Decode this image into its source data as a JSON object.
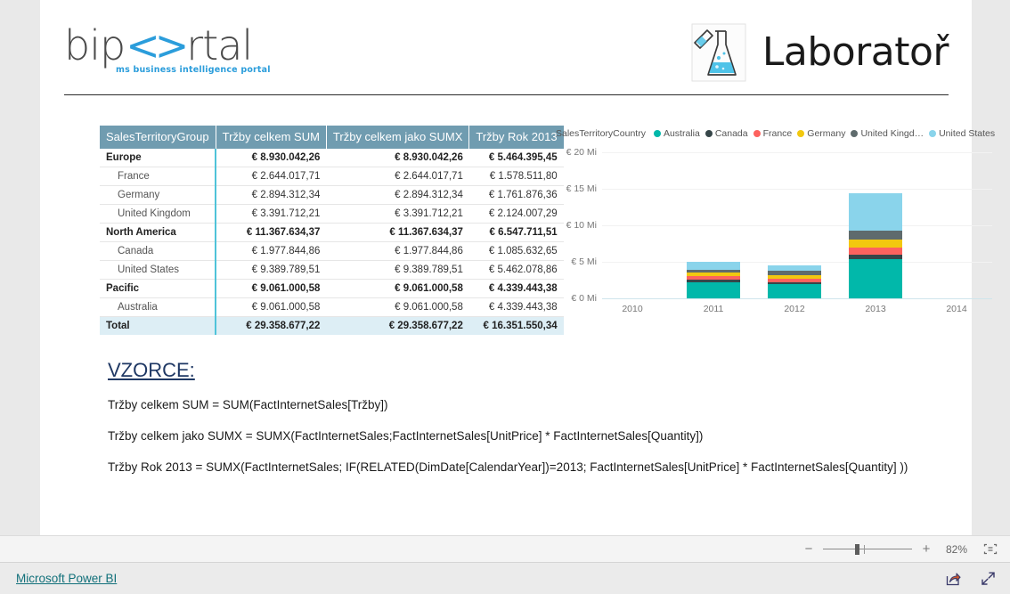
{
  "header": {
    "logo_left": {
      "word_a": "bip",
      "word_diamond": "<>",
      "word_b": "rtal",
      "tagline": "ms business intelligence portal"
    },
    "logo_right": {
      "title": "Laboratoř",
      "icon": "flask-icon"
    }
  },
  "matrix": {
    "columns": [
      "SalesTerritoryGroup",
      "Tržby celkem SUM",
      "Tržby celkem jako SUMX",
      "Tržby Rok 2013"
    ],
    "rows": [
      {
        "type": "group",
        "label": "Europe",
        "sum": "€ 8.930.042,26",
        "sumx": "€ 8.930.042,26",
        "y2013": "€ 5.464.395,45"
      },
      {
        "type": "sub",
        "label": "France",
        "sum": "€ 2.644.017,71",
        "sumx": "€ 2.644.017,71",
        "y2013": "€ 1.578.511,80"
      },
      {
        "type": "sub",
        "label": "Germany",
        "sum": "€ 2.894.312,34",
        "sumx": "€ 2.894.312,34",
        "y2013": "€ 1.761.876,36"
      },
      {
        "type": "sub",
        "label": "United Kingdom",
        "sum": "€ 3.391.712,21",
        "sumx": "€ 3.391.712,21",
        "y2013": "€ 2.124.007,29"
      },
      {
        "type": "group",
        "label": "North America",
        "sum": "€ 11.367.634,37",
        "sumx": "€ 11.367.634,37",
        "y2013": "€ 6.547.711,51"
      },
      {
        "type": "sub",
        "label": "Canada",
        "sum": "€ 1.977.844,86",
        "sumx": "€ 1.977.844,86",
        "y2013": "€ 1.085.632,65"
      },
      {
        "type": "sub",
        "label": "United States",
        "sum": "€ 9.389.789,51",
        "sumx": "€ 9.389.789,51",
        "y2013": "€ 5.462.078,86"
      },
      {
        "type": "group",
        "label": "Pacific",
        "sum": "€ 9.061.000,58",
        "sumx": "€ 9.061.000,58",
        "y2013": "€ 4.339.443,38"
      },
      {
        "type": "sub",
        "label": "Australia",
        "sum": "€ 9.061.000,58",
        "sumx": "€ 9.061.000,58",
        "y2013": "€ 4.339.443,38"
      },
      {
        "type": "total",
        "label": "Total",
        "sum": "€ 29.358.677,22",
        "sumx": "€ 29.358.677,22",
        "y2013": "€ 16.351.550,34"
      }
    ]
  },
  "chart_data": {
    "type": "bar",
    "stacked": true,
    "title": "",
    "legend_title": "SalesTerritoryCountry",
    "legend_position": "top",
    "grid": true,
    "xlabel": "",
    "ylabel": "",
    "categories": [
      "2010",
      "2011",
      "2012",
      "2013"
    ],
    "x_tick_labels": [
      "2010",
      "2011",
      "2012",
      "2014"
    ],
    "x_all_ticks": [
      "2010",
      "2011",
      "2012",
      "2013",
      "2014"
    ],
    "ytick_labels": [
      "€ 0 Mi",
      "€ 5 Mi",
      "€ 10 Mi",
      "€ 15 Mi",
      "€ 20 Mi"
    ],
    "ytick_values": [
      0,
      5000000,
      10000000,
      15000000,
      20000000
    ],
    "ylim": [
      0,
      20000000
    ],
    "series": [
      {
        "name": "Australia",
        "color": "#01b8aa",
        "values": [
          0,
          2150000,
          1900000,
          5350000
        ]
      },
      {
        "name": "Canada",
        "color": "#374649",
        "values": [
          0,
          380000,
          320000,
          650000
        ]
      },
      {
        "name": "France",
        "color": "#fd625e",
        "values": [
          0,
          480000,
          480000,
          900000
        ]
      },
      {
        "name": "Germany",
        "color": "#f2c80f",
        "values": [
          0,
          490000,
          520000,
          1120000
        ]
      },
      {
        "name": "United Kingd…",
        "color": "#5f6b6d",
        "values": [
          0,
          400000,
          530000,
          1300000
        ]
      },
      {
        "name": "United States",
        "color": "#8ad4eb",
        "values": [
          0,
          1100000,
          820000,
          5100000
        ]
      }
    ],
    "totals": [
      0,
      5000000,
      4570000,
      14420000
    ]
  },
  "formulas": {
    "heading": "VZORCE:",
    "items": [
      "Tržby celkem SUM = SUM(FactInternetSales[Tržby])",
      "Tržby celkem jako SUMX = SUMX(FactInternetSales;FactInternetSales[UnitPrice] * FactInternetSales[Quantity])",
      "Tržby Rok 2013 = SUMX(FactInternetSales; IF(RELATED(DimDate[CalendarYear])=2013; FactInternetSales[UnitPrice] * FactInternetSales[Quantity] ))"
    ]
  },
  "zoombar": {
    "minus": "−",
    "plus": "+",
    "zoom_level": "82%",
    "fit_icon": "fit-to-page-icon"
  },
  "footer": {
    "link": "Microsoft Power BI",
    "share_icon": "share-icon",
    "fullscreen_icon": "fullscreen-icon"
  },
  "colors": {
    "header_bg": "#709cb0",
    "total_bg": "#ddeef5",
    "accent": "#4fc3d9",
    "link": "#11707a",
    "heading": "#1f3864"
  }
}
